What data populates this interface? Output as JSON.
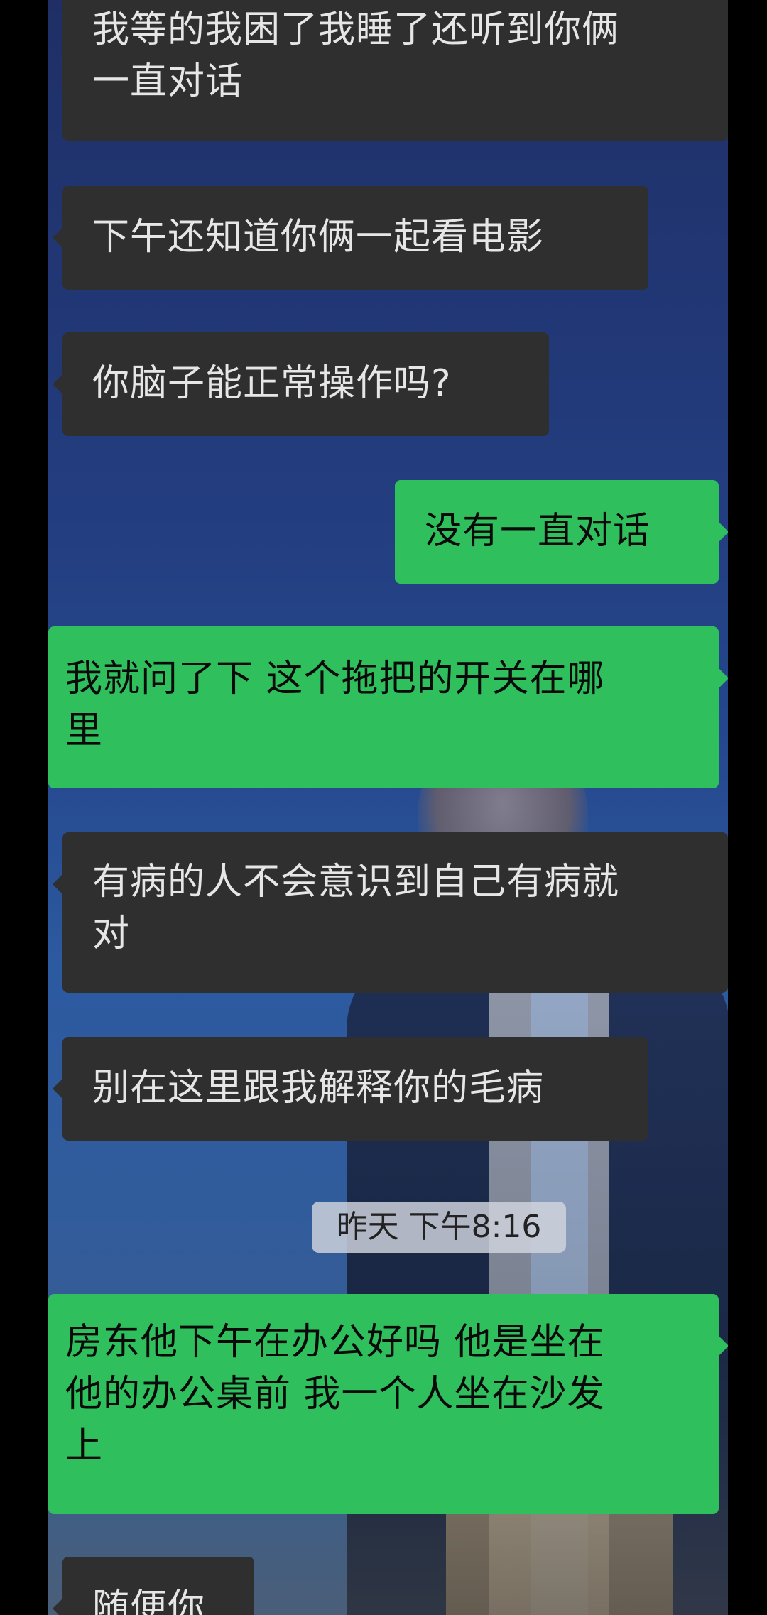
{
  "colors": {
    "incoming_bubble": "#2f2f2f",
    "outgoing_bubble": "#2fbf5c",
    "incoming_text": "#e6e6e6",
    "outgoing_text": "#0a0a0a",
    "timestamp_bg": "#d2d6de"
  },
  "messages": [
    {
      "side": "in",
      "text": "我等的我困了我睡了还听到你俩\n一直对话"
    },
    {
      "side": "in",
      "text": "下午还知道你俩一起看电影"
    },
    {
      "side": "in",
      "text": "你脑子能正常操作吗?"
    },
    {
      "side": "out",
      "text": "没有一直对话"
    },
    {
      "side": "out",
      "text": "我就问了下 这个拖把的开关在哪\n里"
    },
    {
      "side": "in",
      "text": "有病的人不会意识到自己有病就\n对"
    },
    {
      "side": "in",
      "text": "别在这里跟我解释你的毛病"
    },
    {
      "side": "out",
      "text": "房东他下午在办公好吗 他是坐在\n他的办公桌前 我一个人坐在沙发\n上"
    },
    {
      "side": "in",
      "text": "随便你"
    }
  ],
  "timestamp": "昨天 下午8:16"
}
